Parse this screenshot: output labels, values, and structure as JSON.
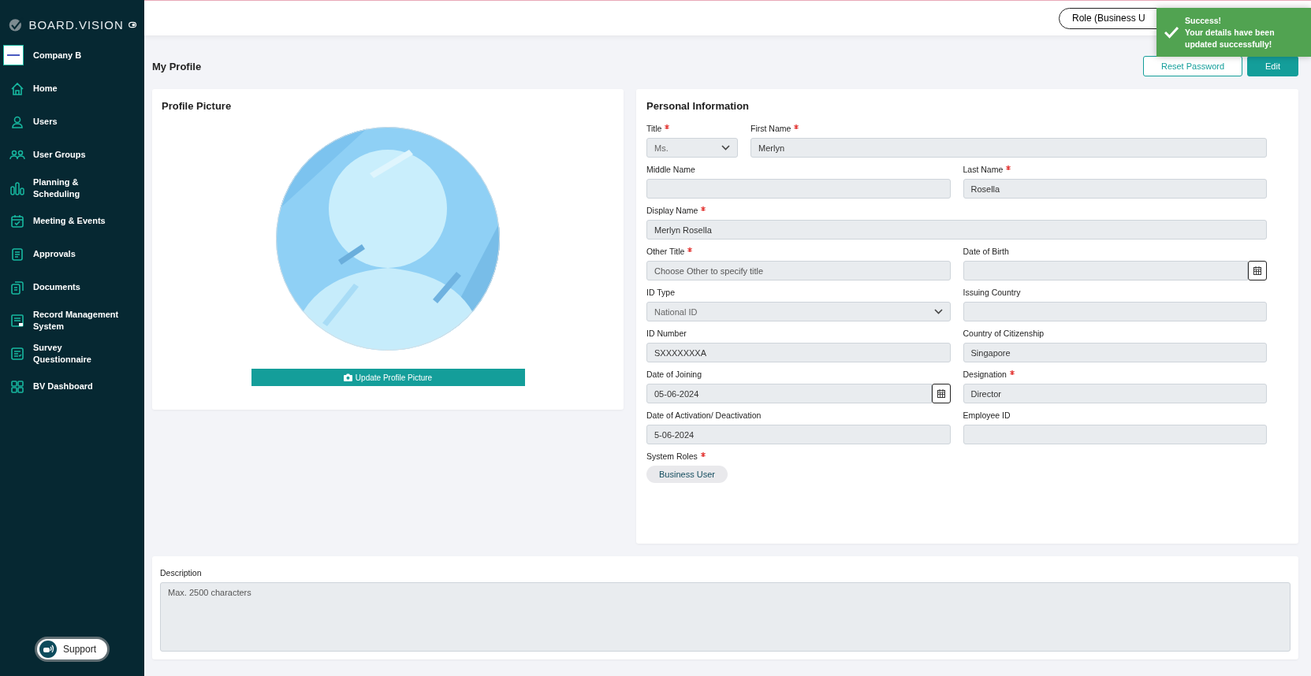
{
  "brand": {
    "name": "BOARD.VISION"
  },
  "company": {
    "name": "Company B"
  },
  "sidebar": {
    "items": [
      {
        "label": "Home"
      },
      {
        "label": "Users"
      },
      {
        "label": "User Groups"
      },
      {
        "label": "Planning & Scheduling"
      },
      {
        "label": "Meeting & Events"
      },
      {
        "label": "Approvals"
      },
      {
        "label": "Documents"
      },
      {
        "label": "Record Management System"
      },
      {
        "label": "Survey Questionnaire"
      },
      {
        "label": "BV Dashboard"
      }
    ]
  },
  "support": {
    "label": "Support"
  },
  "topbar": {
    "role": "Role (Business U"
  },
  "toast": {
    "title": "Success!",
    "message": "Your details have been updated successfully!"
  },
  "page": {
    "title": "My Profile",
    "actions": [
      {
        "label": "Reset Password",
        "kind": "outline"
      },
      {
        "label": "Edit",
        "kind": "primary"
      }
    ]
  },
  "profile_picture": {
    "title": "Profile Picture",
    "button": "Update Profile Picture"
  },
  "personal_information": {
    "title": "Personal Information",
    "rows": [
      {
        "kind": "title-name",
        "fields": [
          {
            "label": "Title",
            "required": true,
            "kind": "select",
            "value": "Ms."
          },
          {
            "label": "First Name",
            "required": true,
            "kind": "text",
            "value": "Merlyn"
          }
        ]
      },
      {
        "kind": "pair",
        "fields": [
          {
            "label": "Middle Name",
            "required": false,
            "kind": "text"
          },
          {
            "label": "Last Name",
            "required": true,
            "kind": "text",
            "value": "Rosella"
          }
        ]
      },
      {
        "kind": "wide",
        "fields": [
          {
            "label": "Display Name",
            "required": true,
            "kind": "text",
            "value": "Merlyn Rosella"
          }
        ]
      },
      {
        "kind": "pair",
        "fields": [
          {
            "label": "Other Title",
            "required": true,
            "kind": "text",
            "placeholder": "Choose Other to specify title"
          },
          {
            "label": "Date of Birth",
            "required": false,
            "kind": "date"
          }
        ]
      },
      {
        "kind": "pair",
        "fields": [
          {
            "label": "ID Type",
            "required": false,
            "kind": "select",
            "value": "National ID"
          },
          {
            "label": "Issuing Country",
            "required": false,
            "kind": "text"
          }
        ]
      },
      {
        "kind": "pair",
        "fields": [
          {
            "label": "ID Number",
            "required": false,
            "kind": "text",
            "value": "SXXXXXXXA"
          },
          {
            "label": "Country of Citizenship",
            "required": false,
            "kind": "text",
            "value": "Singapore"
          }
        ]
      },
      {
        "kind": "pair",
        "fields": [
          {
            "label": "Date of Joining",
            "required": false,
            "kind": "date",
            "value": "05-06-2024"
          },
          {
            "label": "Designation",
            "required": true,
            "kind": "text",
            "value": "Director"
          }
        ]
      },
      {
        "kind": "pair",
        "fields": [
          {
            "label": "Date of Activation/ Deactivation",
            "required": false,
            "kind": "text",
            "value": "5-06-2024"
          },
          {
            "label": "Employee ID",
            "required": false,
            "kind": "text"
          }
        ]
      },
      {
        "kind": "pair",
        "fields": [
          {
            "label": "System Roles",
            "required": true,
            "kind": "chips",
            "chips": [
              "Business User"
            ]
          }
        ]
      }
    ]
  },
  "description": {
    "label": "Description",
    "placeholder": "Max. 2500 characters"
  }
}
